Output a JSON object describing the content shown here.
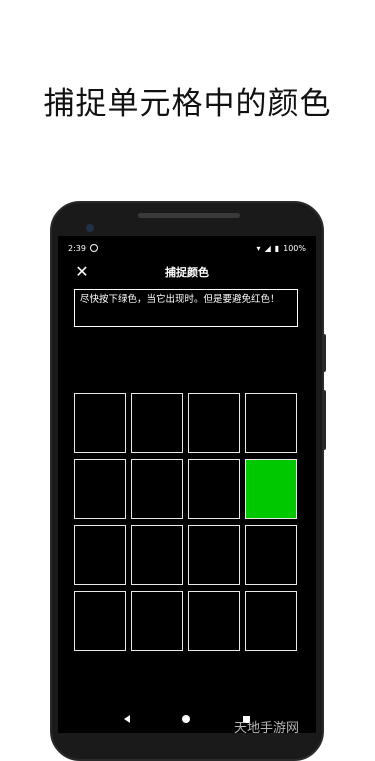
{
  "promo": {
    "title": "捕捉单元格中的颜色"
  },
  "statusbar": {
    "time": "2:39",
    "battery": "100%"
  },
  "appbar": {
    "title": "捕捉颜色"
  },
  "instructions": {
    "text": "尽快按下绿色，当它出现时。但是要避免红色！"
  },
  "grid": {
    "rows": 4,
    "cols": 4,
    "cells": [
      "empty",
      "empty",
      "empty",
      "empty",
      "empty",
      "empty",
      "empty",
      "green",
      "empty",
      "empty",
      "empty",
      "empty",
      "empty",
      "empty",
      "empty",
      "empty"
    ]
  },
  "colors": {
    "green": "#00c800",
    "background": "#000000",
    "cell_border": "#e8e8e8"
  },
  "watermark": {
    "text": "天地手游网"
  }
}
